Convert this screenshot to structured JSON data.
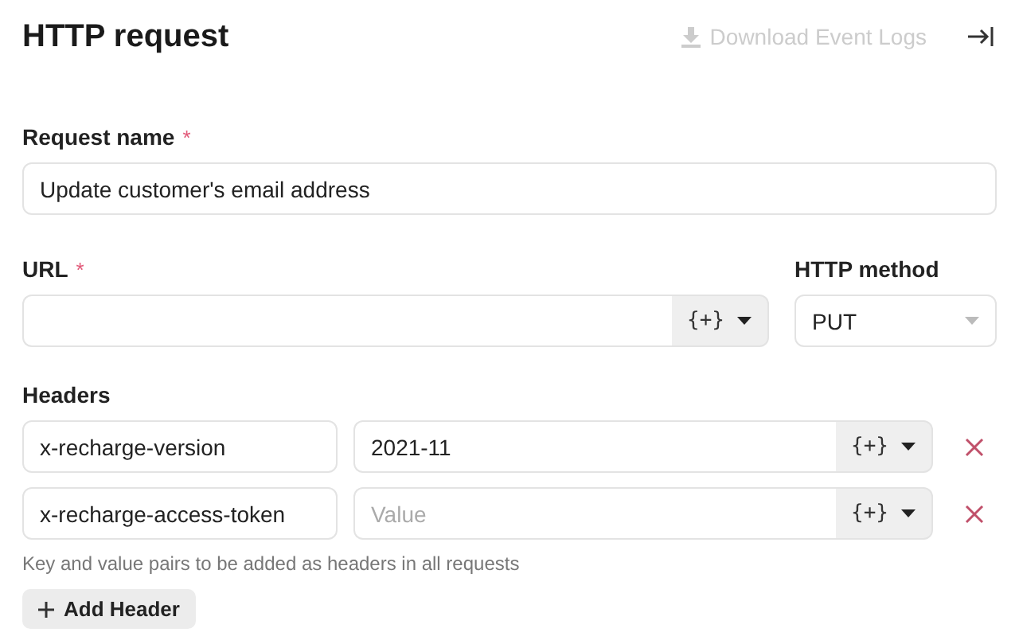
{
  "header": {
    "title": "HTTP request",
    "download_button": {
      "label": "Download Event Logs",
      "disabled": true
    }
  },
  "request_name": {
    "label": "Request name",
    "required_mark": "*",
    "value": "Update customer's email address"
  },
  "url": {
    "label": "URL",
    "required_mark": "*",
    "variable_button": "{+}"
  },
  "http_method": {
    "label": "HTTP method",
    "value": "PUT"
  },
  "headers": {
    "label": "Headers",
    "rows": [
      {
        "key": "x-recharge-version",
        "value": "2021-11",
        "variable_button": "{+}"
      },
      {
        "key": "x-recharge-access-token",
        "placeholder": "Value",
        "variable_button": "{+}"
      }
    ],
    "hint": "Key and value pairs to be added as headers in all requests",
    "add_button": "Add Header"
  }
}
